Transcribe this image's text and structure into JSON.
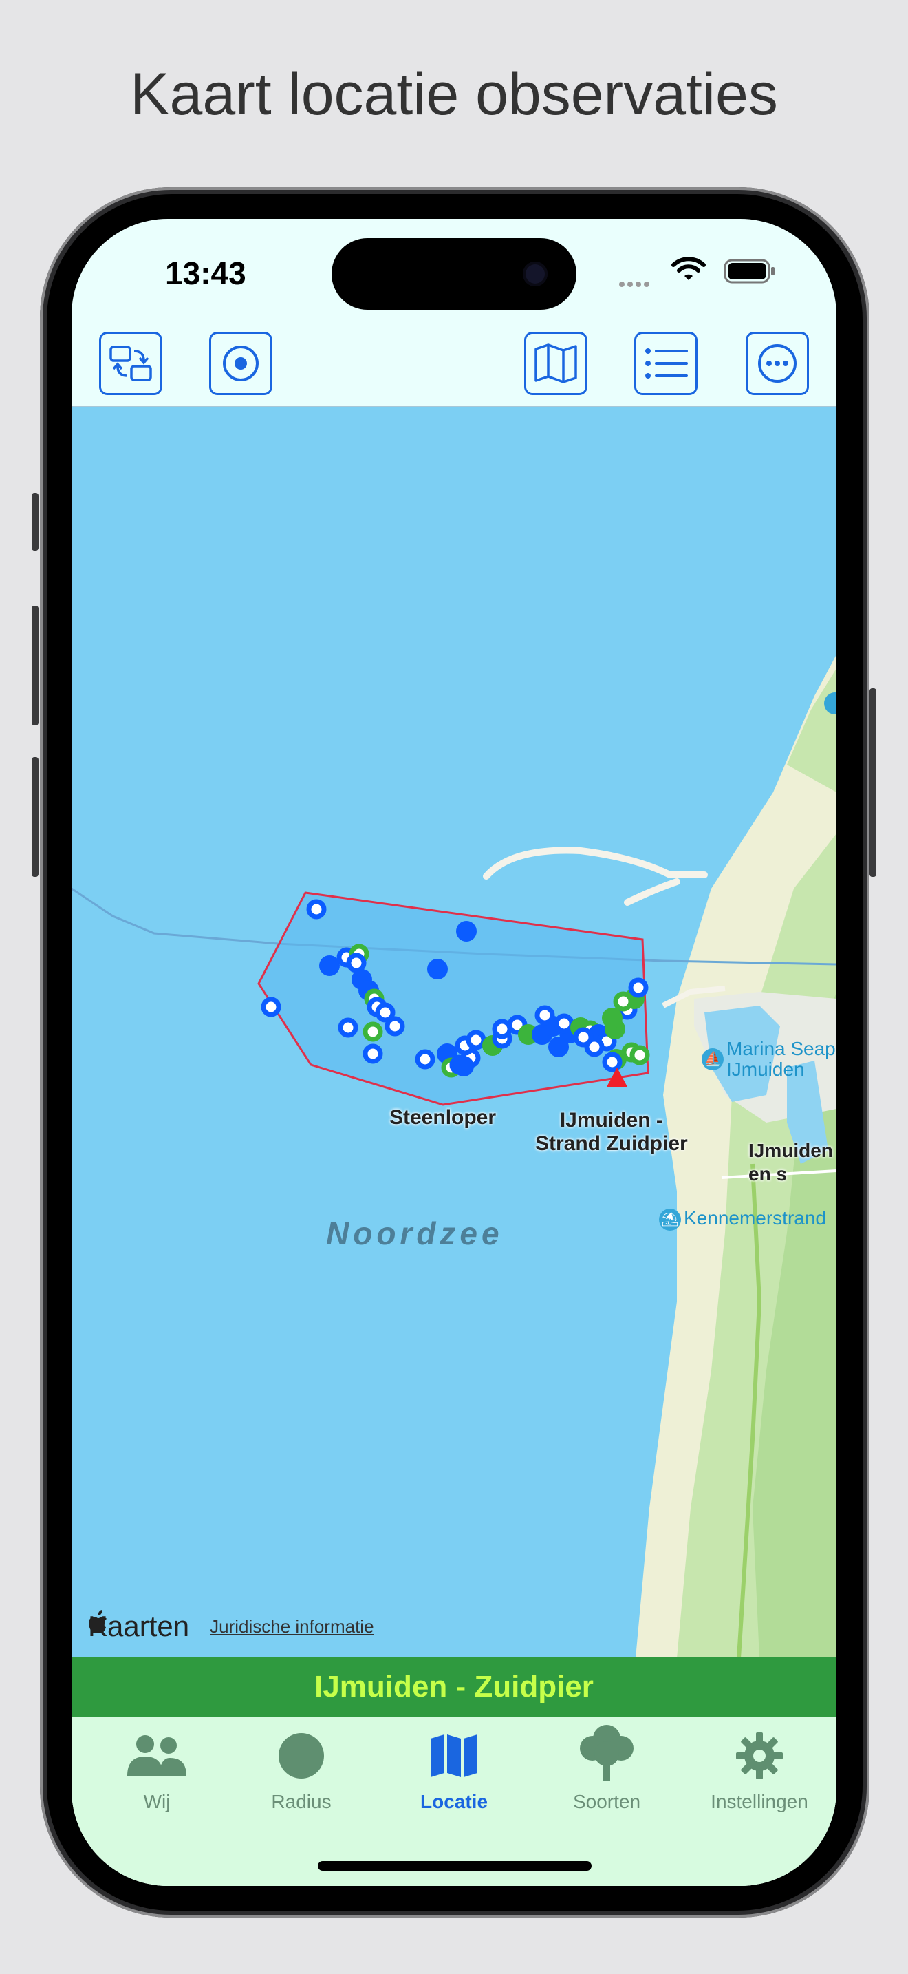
{
  "headline": "Kaart locatie observaties",
  "status": {
    "time": "13:43"
  },
  "toolbar": {
    "left_icons": [
      "swap-icon",
      "target-icon"
    ],
    "right_icons": [
      "map-icon",
      "list-icon",
      "more-icon"
    ]
  },
  "map": {
    "labels": {
      "sea": "Noordzee",
      "steenloper": "Steenloper",
      "zuidpier": "IJmuiden -\nStrand Zuidpier",
      "marina": "Marina Seaport\nIJmuiden",
      "ijmuiden_partial": "IJmuiden\nen s",
      "kennemer": "Kennemerstrand"
    },
    "attribution": {
      "brand": "Kaarten",
      "legal": "Juridische informatie"
    },
    "colors": {
      "sea": "#7ccff3",
      "land": "#eef0d6",
      "green": "#b8e0a0",
      "marker_blue": "#0b5cff",
      "marker_green": "#3cb43c",
      "polygon": "#e0304a"
    }
  },
  "location_bar": {
    "name": "IJmuiden - Zuidpier"
  },
  "tabs": [
    {
      "label": "Wij",
      "icon": "people-icon"
    },
    {
      "label": "Radius",
      "icon": "circle-icon"
    },
    {
      "label": "Locatie",
      "icon": "map-icon",
      "active": true
    },
    {
      "label": "Soorten",
      "icon": "tree-icon"
    },
    {
      "label": "Instellingen",
      "icon": "gear-icon"
    }
  ]
}
